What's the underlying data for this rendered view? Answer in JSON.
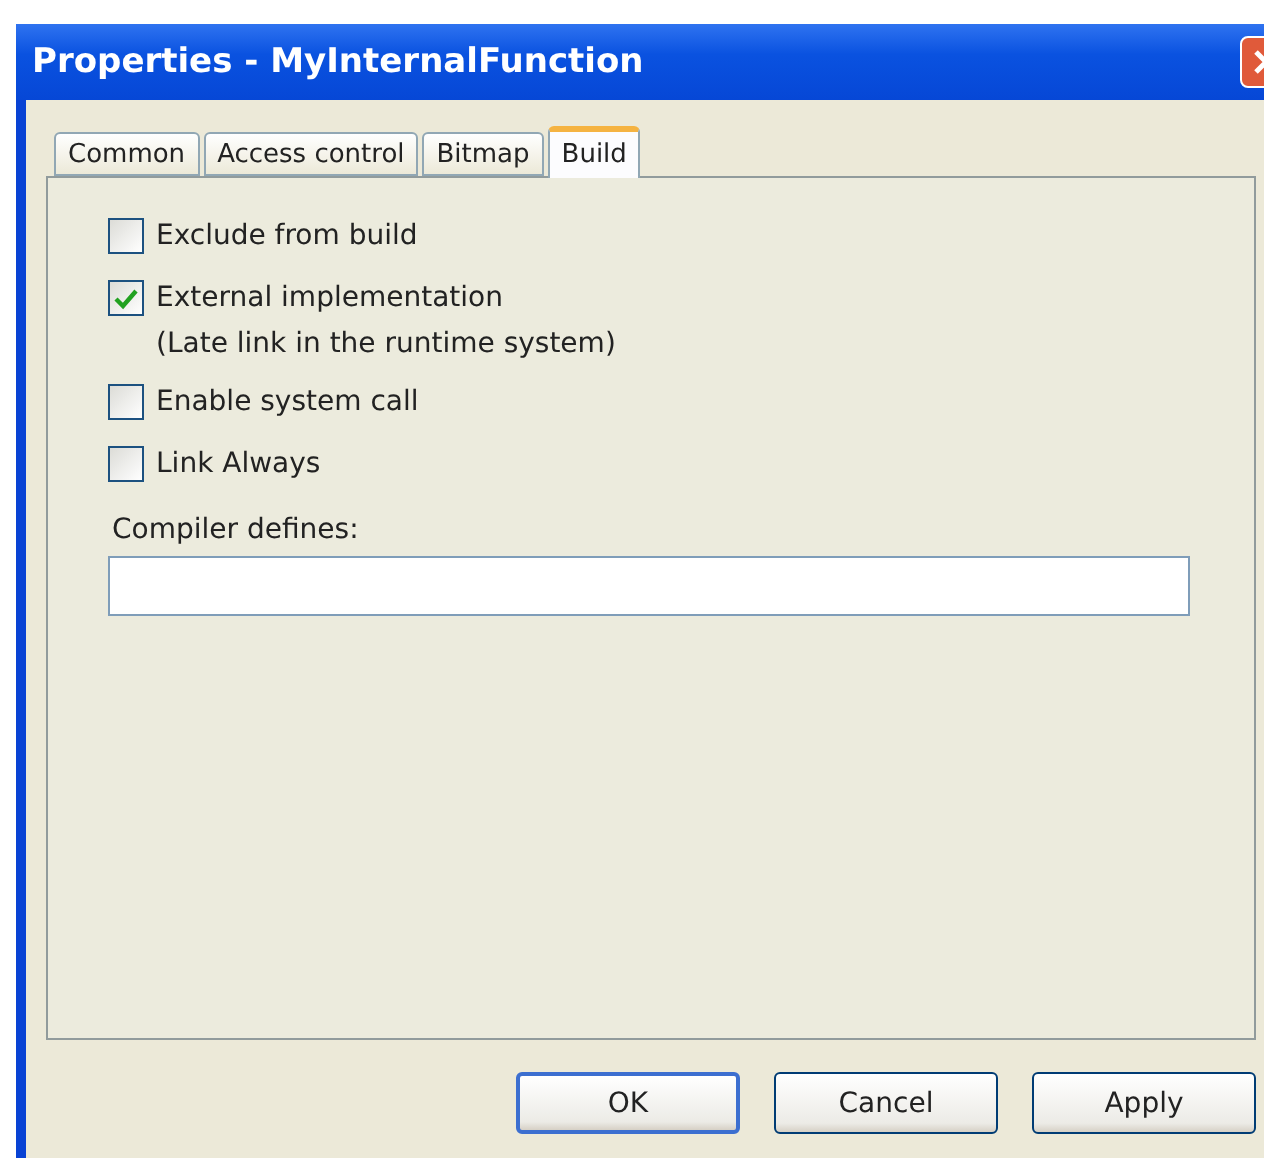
{
  "window": {
    "title": "Properties - MyInternalFunction"
  },
  "tabs": [
    {
      "label": "Common",
      "selected": false
    },
    {
      "label": "Access control",
      "selected": false
    },
    {
      "label": "Bitmap",
      "selected": false
    },
    {
      "label": "Build",
      "selected": true
    }
  ],
  "options": [
    {
      "label": "Exclude from build",
      "checked": false
    },
    {
      "label": "External implementation",
      "note": "(Late link in the runtime system)",
      "checked": true
    },
    {
      "label": "Enable system call",
      "checked": false
    },
    {
      "label": "Link Always",
      "checked": false
    }
  ],
  "compiler_defines": {
    "label": "Compiler defines:"
  },
  "buttons": [
    {
      "label": "OK",
      "default": true
    },
    {
      "label": "Cancel",
      "default": false
    },
    {
      "label": "Apply",
      "default": false
    }
  ]
}
